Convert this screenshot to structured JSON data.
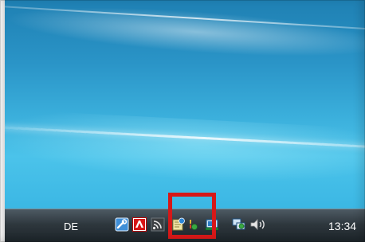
{
  "taskbar": {
    "language": "DE",
    "clock": "13:34"
  },
  "tray": {
    "icons": [
      "tools-icon",
      "antivirus-umbrella-icon",
      "wireless-network-icon",
      "program-update-icon",
      "flag-icon",
      "hardware-device-icon",
      "network-connection-icon",
      "volume-icon"
    ]
  },
  "highlight": {
    "color": "#d61818"
  },
  "colors": {
    "desktop_top": "#1f80b3",
    "desktop_bottom": "#4bc3ea",
    "taskbar": "#2e373d"
  }
}
